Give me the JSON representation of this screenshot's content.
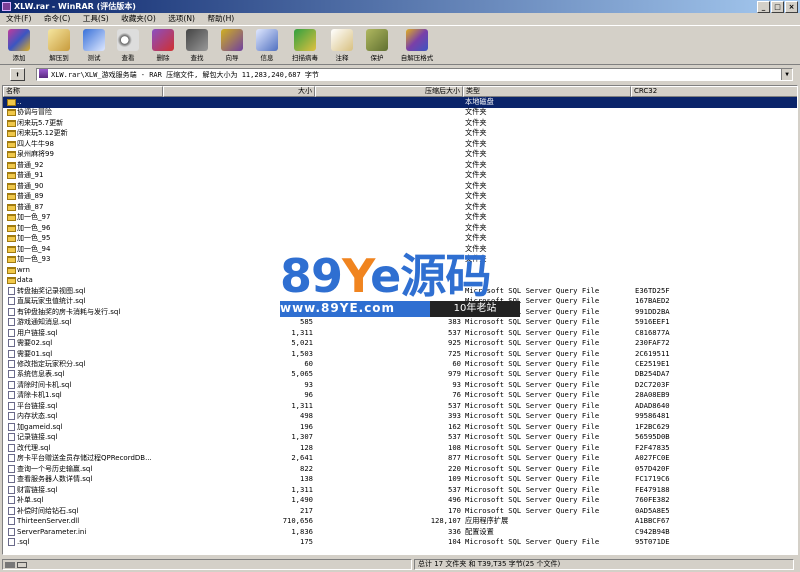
{
  "window": {
    "title": "XLW.rar - WinRAR (评估版本)",
    "btn_min": "_",
    "btn_max": "□",
    "btn_close": "×"
  },
  "menu": [
    "文件(F)",
    "命令(C)",
    "工具(S)",
    "收藏夹(O)",
    "选项(N)",
    "帮助(H)"
  ],
  "toolbar": [
    {
      "label": "添加",
      "icon": "add-archive-icon"
    },
    {
      "label": "解压到",
      "icon": "extract-to-icon"
    },
    {
      "label": "测试",
      "icon": "test-icon"
    },
    {
      "label": "查看",
      "icon": "view-icon"
    },
    {
      "label": "删除",
      "icon": "delete-icon"
    },
    {
      "label": "查找",
      "icon": "find-icon"
    },
    {
      "label": "向导",
      "icon": "wizard-icon"
    },
    {
      "label": "信息",
      "icon": "info-icon"
    },
    {
      "label": "扫描病毒",
      "icon": "virus-scan-icon"
    },
    {
      "label": "注释",
      "icon": "comment-icon"
    },
    {
      "label": "保护",
      "icon": "protect-icon"
    },
    {
      "label": "自解压格式",
      "icon": "sfx-icon"
    }
  ],
  "address": {
    "up_glyph": "⬆",
    "path": "XLW.rar\\XLW_游戏服务端 - RAR 压缩文件, 解包大小为 11,283,240,687 字节",
    "drop": "▼"
  },
  "columns": {
    "name": "名称",
    "size": "大小",
    "packed": "压缩后大小",
    "type": "类型",
    "crc": "CRC32",
    "sort": "△"
  },
  "rows": [
    {
      "kind": "up",
      "name": "..",
      "size": "",
      "packed": "",
      "type": "本地磁盘",
      "crc": "",
      "selected": true
    },
    {
      "kind": "folder",
      "name": "协调与冒险",
      "size": "",
      "packed": "",
      "type": "文件夹",
      "crc": ""
    },
    {
      "kind": "folder",
      "name": "闲来玩5.7更新",
      "size": "",
      "packed": "",
      "type": "文件夹",
      "crc": ""
    },
    {
      "kind": "folder",
      "name": "闲来玩5.12更新",
      "size": "",
      "packed": "",
      "type": "文件夹",
      "crc": ""
    },
    {
      "kind": "folder",
      "name": "四人牛牛98",
      "size": "",
      "packed": "",
      "type": "文件夹",
      "crc": ""
    },
    {
      "kind": "folder",
      "name": "泉州麻将99",
      "size": "",
      "packed": "",
      "type": "文件夹",
      "crc": ""
    },
    {
      "kind": "folder",
      "name": "普通_92",
      "size": "",
      "packed": "",
      "type": "文件夹",
      "crc": ""
    },
    {
      "kind": "folder",
      "name": "普通_91",
      "size": "",
      "packed": "",
      "type": "文件夹",
      "crc": ""
    },
    {
      "kind": "folder",
      "name": "普通_90",
      "size": "",
      "packed": "",
      "type": "文件夹",
      "crc": ""
    },
    {
      "kind": "folder",
      "name": "普通_89",
      "size": "",
      "packed": "",
      "type": "文件夹",
      "crc": ""
    },
    {
      "kind": "folder",
      "name": "普通_87",
      "size": "",
      "packed": "",
      "type": "文件夹",
      "crc": ""
    },
    {
      "kind": "folder",
      "name": "加一色_97",
      "size": "",
      "packed": "",
      "type": "文件夹",
      "crc": ""
    },
    {
      "kind": "folder",
      "name": "加一色_96",
      "size": "",
      "packed": "",
      "type": "文件夹",
      "crc": ""
    },
    {
      "kind": "folder",
      "name": "加一色_95",
      "size": "",
      "packed": "",
      "type": "文件夹",
      "crc": ""
    },
    {
      "kind": "folder",
      "name": "加一色_94",
      "size": "",
      "packed": "",
      "type": "文件夹",
      "crc": ""
    },
    {
      "kind": "folder",
      "name": "加一色_93",
      "size": "",
      "packed": "",
      "type": "文件夹",
      "crc": ""
    },
    {
      "kind": "folder",
      "name": "wrn",
      "size": "",
      "packed": "",
      "type": "",
      "crc": ""
    },
    {
      "kind": "folder",
      "name": "data",
      "size": "",
      "packed": "",
      "type": "",
      "crc": ""
    },
    {
      "kind": "file",
      "name": "转盘抽奖记录视图.sql",
      "size": "",
      "packed": "",
      "type": "Microsoft SQL Server Query File",
      "crc": "E36TD25F"
    },
    {
      "kind": "file",
      "name": "直属玩家虫值统计.sql",
      "size": "",
      "packed": "",
      "type": "Microsoft SQL Server Query File",
      "crc": "167BAED2"
    },
    {
      "kind": "file",
      "name": "有钟盘抽奖的房卡消耗与发行.sql",
      "size": "",
      "packed": "",
      "type": "Microsoft SQL Server Query File",
      "crc": "991DD2BA"
    },
    {
      "kind": "file",
      "name": "游戏通知消息.sql",
      "size": "585",
      "packed": "383",
      "type": "Microsoft SQL Server Query File",
      "crc": "5916EEF1"
    },
    {
      "kind": "file",
      "name": "用户链接.sql",
      "size": "1,311",
      "packed": "537",
      "type": "Microsoft SQL Server Query File",
      "crc": "C816877A"
    },
    {
      "kind": "file",
      "name": "需要02.sql",
      "size": "5,021",
      "packed": "925",
      "type": "Microsoft SQL Server Query File",
      "crc": "230FAF72"
    },
    {
      "kind": "file",
      "name": "需要01.sql",
      "size": "1,503",
      "packed": "725",
      "type": "Microsoft SQL Server Query File",
      "crc": "2C619511"
    },
    {
      "kind": "file",
      "name": "修改指定玩家积分.sql",
      "size": "60",
      "packed": "60",
      "type": "Microsoft SQL Server Query File",
      "crc": "CE2519E1"
    },
    {
      "kind": "file",
      "name": "系统信息表.sql",
      "size": "5,065",
      "packed": "979",
      "type": "Microsoft SQL Server Query File",
      "crc": "DB254DA7"
    },
    {
      "kind": "file",
      "name": "清除时间卡机.sql",
      "size": "93",
      "packed": "93",
      "type": "Microsoft SQL Server Query File",
      "crc": "D2C7203F"
    },
    {
      "kind": "file",
      "name": "清除卡机1.sql",
      "size": "96",
      "packed": "76",
      "type": "Microsoft SQL Server Query File",
      "crc": "28A08EB9"
    },
    {
      "kind": "file",
      "name": "平台链接.sql",
      "size": "1,311",
      "packed": "537",
      "type": "Microsoft SQL Server Query File",
      "crc": "ADAD8640"
    },
    {
      "kind": "file",
      "name": "内存状态.sql",
      "size": "498",
      "packed": "393",
      "type": "Microsoft SQL Server Query File",
      "crc": "99586481"
    },
    {
      "kind": "file",
      "name": "加gameid.sql",
      "size": "196",
      "packed": "162",
      "type": "Microsoft SQL Server Query File",
      "crc": "1F2BC629"
    },
    {
      "kind": "file",
      "name": "记录链接.sql",
      "size": "1,307",
      "packed": "537",
      "type": "Microsoft SQL Server Query File",
      "crc": "56595D0B"
    },
    {
      "kind": "file",
      "name": "改代理.sql",
      "size": "128",
      "packed": "108",
      "type": "Microsoft SQL Server Query File",
      "crc": "F2F47835"
    },
    {
      "kind": "file",
      "name": "房卡平台赠送金员存储过程QPRecordDB...",
      "size": "2,641",
      "packed": "877",
      "type": "Microsoft SQL Server Query File",
      "crc": "A027FC0E"
    },
    {
      "kind": "file",
      "name": "查询一个号历史输赢.sql",
      "size": "822",
      "packed": "220",
      "type": "Microsoft SQL Server Query File",
      "crc": "057D420F"
    },
    {
      "kind": "file",
      "name": "查看服务器人数详情.sql",
      "size": "138",
      "packed": "109",
      "type": "Microsoft SQL Server Query File",
      "crc": "FC1719C6"
    },
    {
      "kind": "file",
      "name": "财富链接.sql",
      "size": "1,311",
      "packed": "537",
      "type": "Microsoft SQL Server Query File",
      "crc": "FE479188"
    },
    {
      "kind": "file",
      "name": "补单.sql",
      "size": "1,490",
      "packed": "496",
      "type": "Microsoft SQL Server Query File",
      "crc": "760FE382"
    },
    {
      "kind": "file",
      "name": "补偿时间给钻石.sql",
      "size": "217",
      "packed": "170",
      "type": "Microsoft SQL Server Query File",
      "crc": "0AD5A8E5"
    },
    {
      "kind": "file",
      "name": "ThirteenServer.dll",
      "size": "710,656",
      "packed": "128,107",
      "type": "应用程序扩展",
      "crc": "A1BBCF67"
    },
    {
      "kind": "file",
      "name": "ServerParameter.ini",
      "size": "1,836",
      "packed": "336",
      "type": "配置设置",
      "crc": "C942B94B"
    },
    {
      "kind": "file",
      "name": ".sql",
      "size": "175",
      "packed": "104",
      "type": "Microsoft SQL Server Query File",
      "crc": "95T071DE"
    }
  ],
  "status": {
    "right": "总计 17 文件夹 和 T39,T35 字节(25 个文件)"
  },
  "watermark": {
    "brand_a": "89",
    "brand_b": "Y",
    "brand_c": "e",
    "brand_d": "源码",
    "url": "www.89YE.com",
    "tag": "10年老站"
  }
}
